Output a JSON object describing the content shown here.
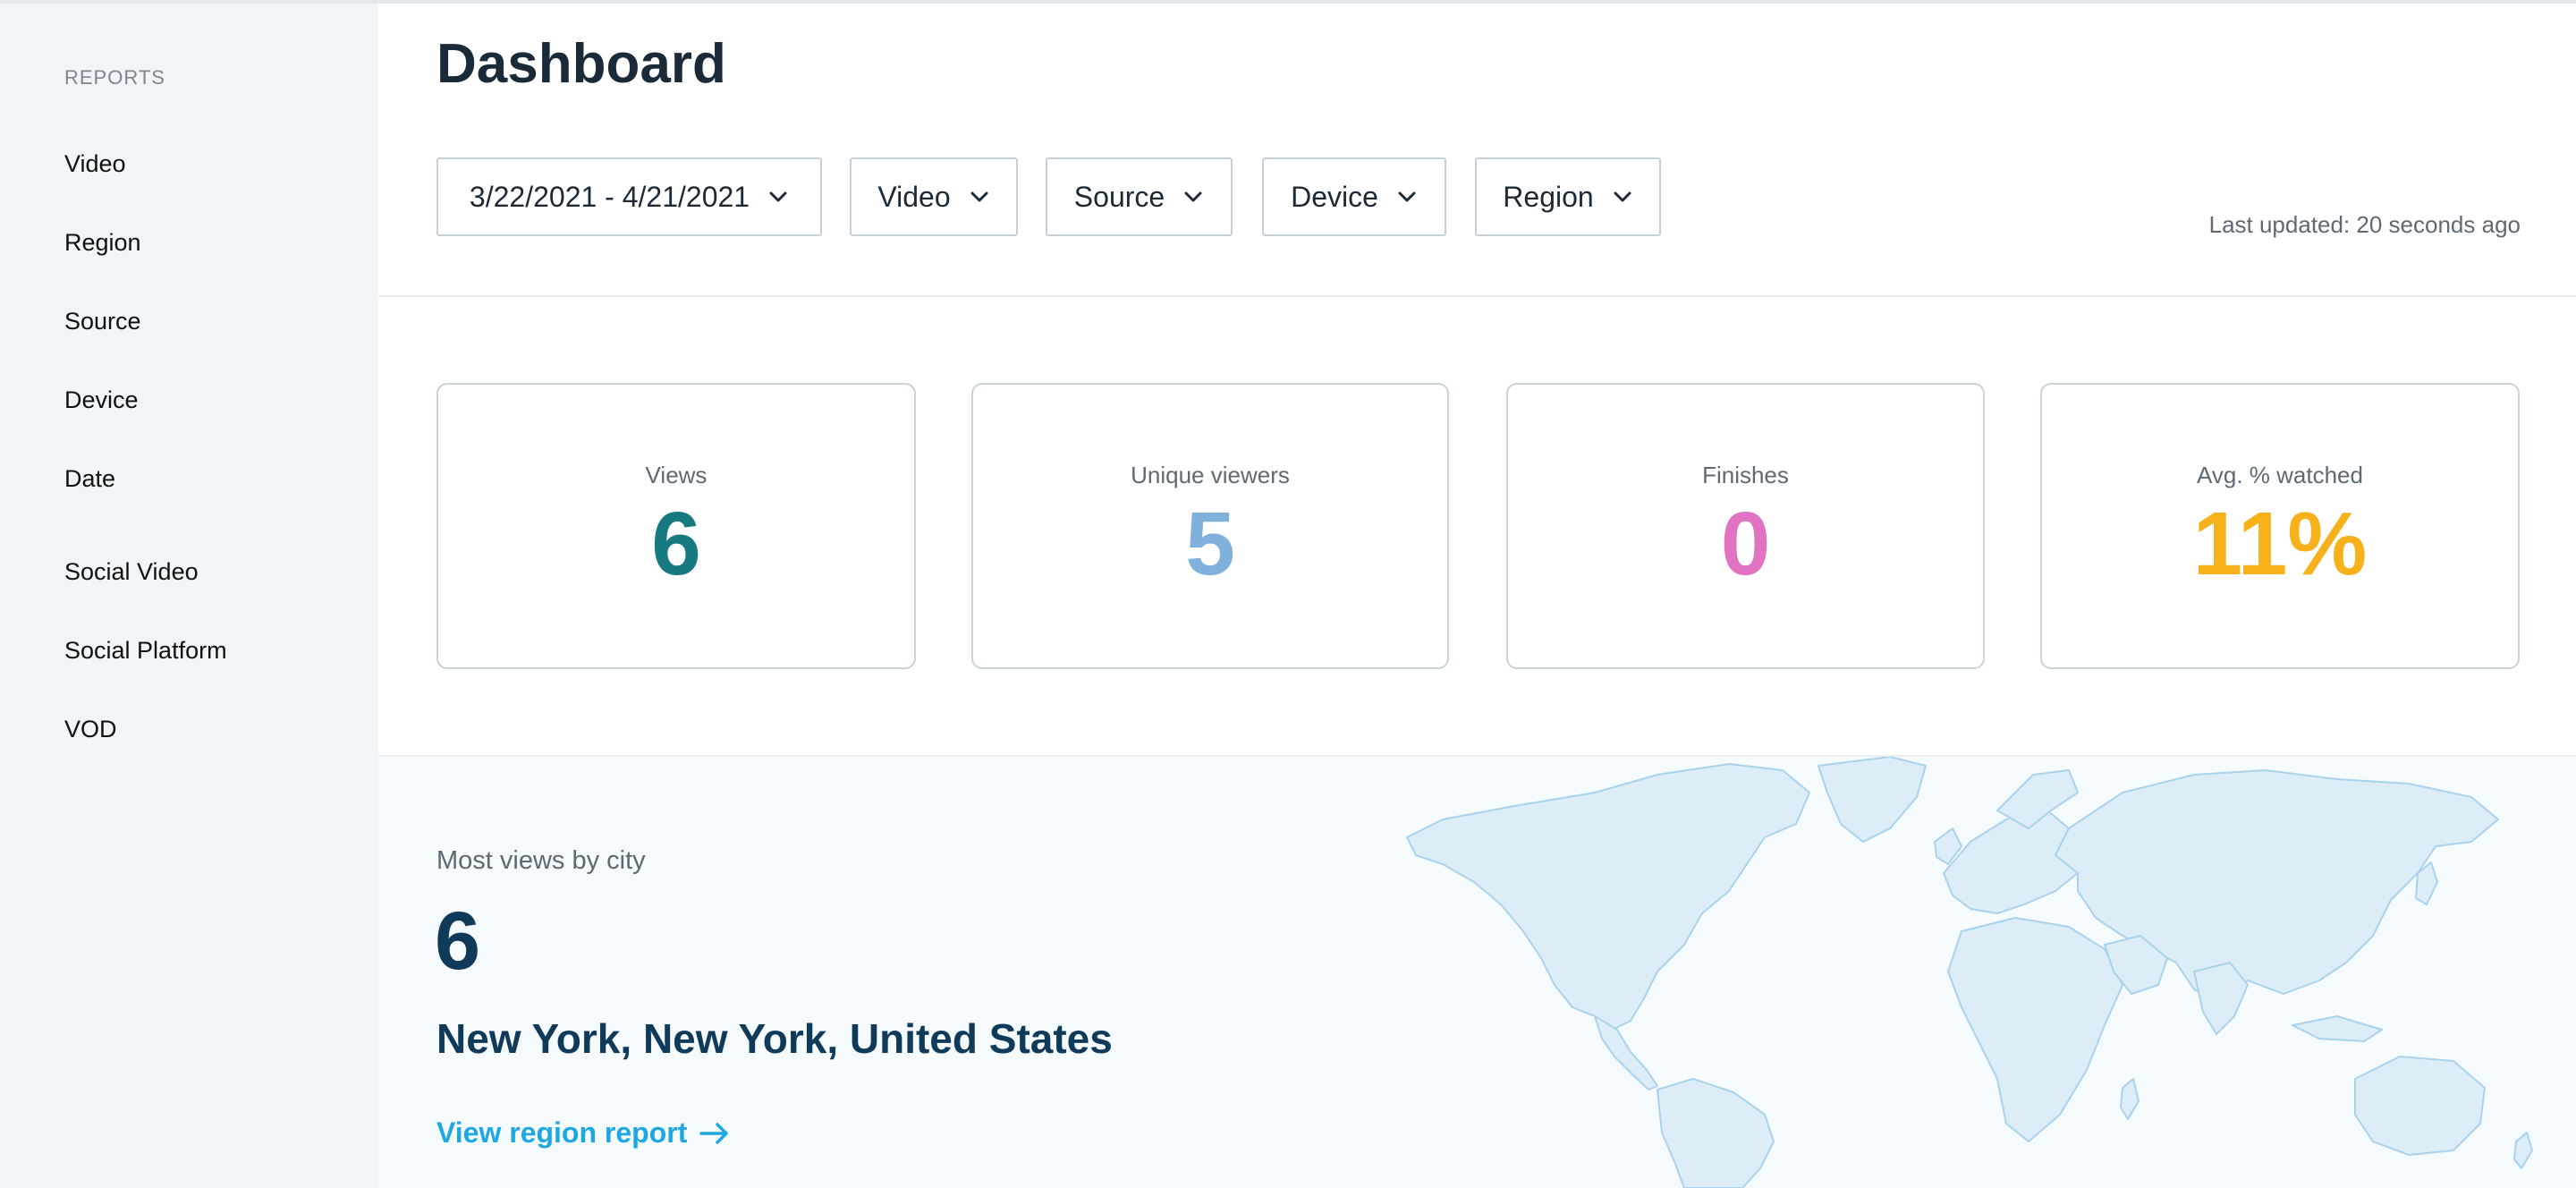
{
  "sidebar": {
    "heading": "REPORTS",
    "items": [
      {
        "label": "Video"
      },
      {
        "label": "Region"
      },
      {
        "label": "Source"
      },
      {
        "label": "Device"
      },
      {
        "label": "Date"
      },
      {
        "label": "Social Video"
      },
      {
        "label": "Social Platform"
      },
      {
        "label": "VOD"
      }
    ]
  },
  "header": {
    "title": "Dashboard",
    "last_updated": "Last updated: 20 seconds ago"
  },
  "filters": {
    "date_range": "3/22/2021 - 4/21/2021",
    "video": "Video",
    "source": "Source",
    "device": "Device",
    "region": "Region"
  },
  "stats": [
    {
      "label": "Views",
      "value": "6",
      "color": "#167a80"
    },
    {
      "label": "Unique viewers",
      "value": "5",
      "color": "#7fb1dc"
    },
    {
      "label": "Finishes",
      "value": "0",
      "color": "#e272c2"
    },
    {
      "label": "Avg. % watched",
      "value": "11%",
      "color": "#f7b21b"
    }
  ],
  "city": {
    "label": "Most views by city",
    "count": "6",
    "name": "New York, New York, United States",
    "link": "View region report"
  },
  "icons": {
    "filter_chevron": "chevron-down-icon",
    "link_arrow": "arrow-right-icon",
    "map": "world-map"
  },
  "colors": {
    "sidebar_bg": "#f1f5f8",
    "link": "#1ea7e1",
    "map_fill": "#dcedf7",
    "map_stroke": "#a9d3ec"
  }
}
